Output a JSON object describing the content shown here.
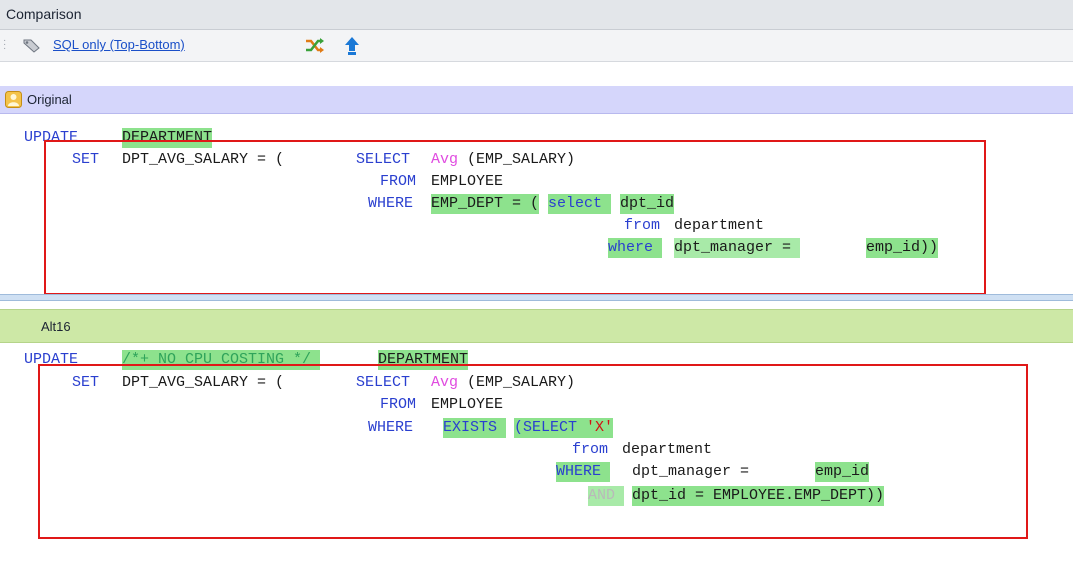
{
  "window": {
    "title": "Comparison"
  },
  "toolbar": {
    "view_mode_label": "SQL only (Top-Bottom)"
  },
  "original": {
    "label": "Original",
    "lines": [
      [
        "UPDATE ",
        "DEPARTMENT"
      ],
      [
        "SET ",
        "DPT_AVG_SALARY = (",
        "SELECT ",
        "Avg",
        "(EMP_SALARY)"
      ],
      [
        "FROM ",
        "EMPLOYEE"
      ],
      [
        "WHERE ",
        "EMP_DEPT = (",
        "select ",
        "dpt_id"
      ],
      [
        "from ",
        "department"
      ],
      [
        "where ",
        "dpt_manager = ",
        "emp_id))"
      ]
    ]
  },
  "alt": {
    "label": "Alt16",
    "lines": [
      [
        "UPDATE ",
        "/*+ NO_CPU_COSTING */ ",
        "DEPARTMENT"
      ],
      [
        "SET ",
        "DPT_AVG_SALARY = (",
        "SELECT ",
        "Avg",
        "(EMP_SALARY)"
      ],
      [
        "FROM ",
        "EMPLOYEE"
      ],
      [
        "WHERE ",
        "EXISTS ",
        "(SELECT ",
        "'X'"
      ],
      [
        "from ",
        "department"
      ],
      [
        "WHERE ",
        "dpt_manager = ",
        "emp_id"
      ],
      [
        "AND ",
        "dpt_id = EMPLOYEE.EMP_DEPT))"
      ]
    ]
  },
  "icons": {
    "tag": "tag-icon",
    "shuffle": "shuffle-icon",
    "move_up": "arrow-up-icon",
    "user": "user-icon"
  },
  "colors": {
    "keyword": "#2a3fcf",
    "function": "#e04be0",
    "string": "#d01414",
    "comment": "#2fa35a",
    "highlight": "#8de28d",
    "outline": "#e01818",
    "original_header": "#d5d6fb",
    "alt_header": "#cde8a6"
  }
}
